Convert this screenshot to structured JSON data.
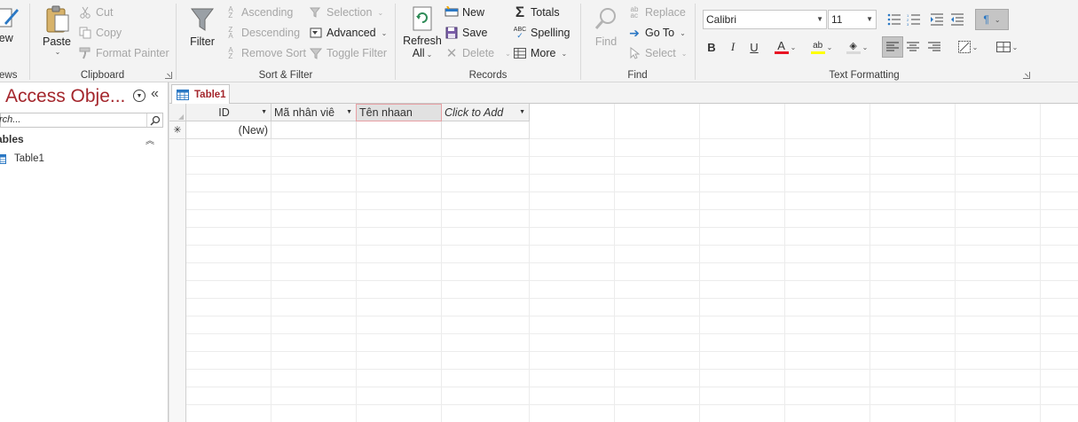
{
  "ribbon": {
    "views": {
      "view_label": "iew",
      "group_label": "ews"
    },
    "clipboard": {
      "paste_label": "Paste",
      "cut_label": "Cut",
      "copy_label": "Copy",
      "format_painter_label": "Format Painter",
      "group_label": "Clipboard"
    },
    "sort_filter": {
      "filter_label": "Filter",
      "ascending_label": "Ascending",
      "descending_label": "Descending",
      "remove_sort_label": "Remove Sort",
      "selection_label": "Selection",
      "advanced_label": "Advanced",
      "toggle_filter_label": "Toggle Filter",
      "group_label": "Sort & Filter"
    },
    "records": {
      "refresh_label_1": "Refresh",
      "refresh_label_2": "All",
      "new_label": "New",
      "save_label": "Save",
      "delete_label": "Delete",
      "totals_label": "Totals",
      "spelling_label": "Spelling",
      "more_label": "More",
      "group_label": "Records"
    },
    "find": {
      "find_label": "Find",
      "replace_label": "Replace",
      "goto_label": "Go To",
      "select_label": "Select",
      "group_label": "Find"
    },
    "text_formatting": {
      "font_name": "Calibri",
      "font_size": "11",
      "bold": "B",
      "italic": "I",
      "underline": "U",
      "font_color": "#e81123",
      "highlight_color": "#ffff00",
      "group_label": "Text Formatting"
    }
  },
  "nav_pane": {
    "title": "ll Access Obje...",
    "search_placeholder": "rch...",
    "section_label": "ables",
    "items": [
      {
        "label": "Table1"
      }
    ]
  },
  "document": {
    "tabs": [
      {
        "label": "Table1"
      }
    ],
    "table": {
      "columns": [
        {
          "label": "ID"
        },
        {
          "label": "Mã nhân viê"
        },
        {
          "label": "Tên nhaan"
        },
        {
          "label": "Click to Add"
        }
      ],
      "new_row_marker": "✳",
      "new_row_id": "(New)"
    }
  },
  "colors": {
    "accent_red": "#a4262c",
    "ribbon_bg": "#f3f3f3",
    "selected_header_border": "#e8a0a4"
  }
}
